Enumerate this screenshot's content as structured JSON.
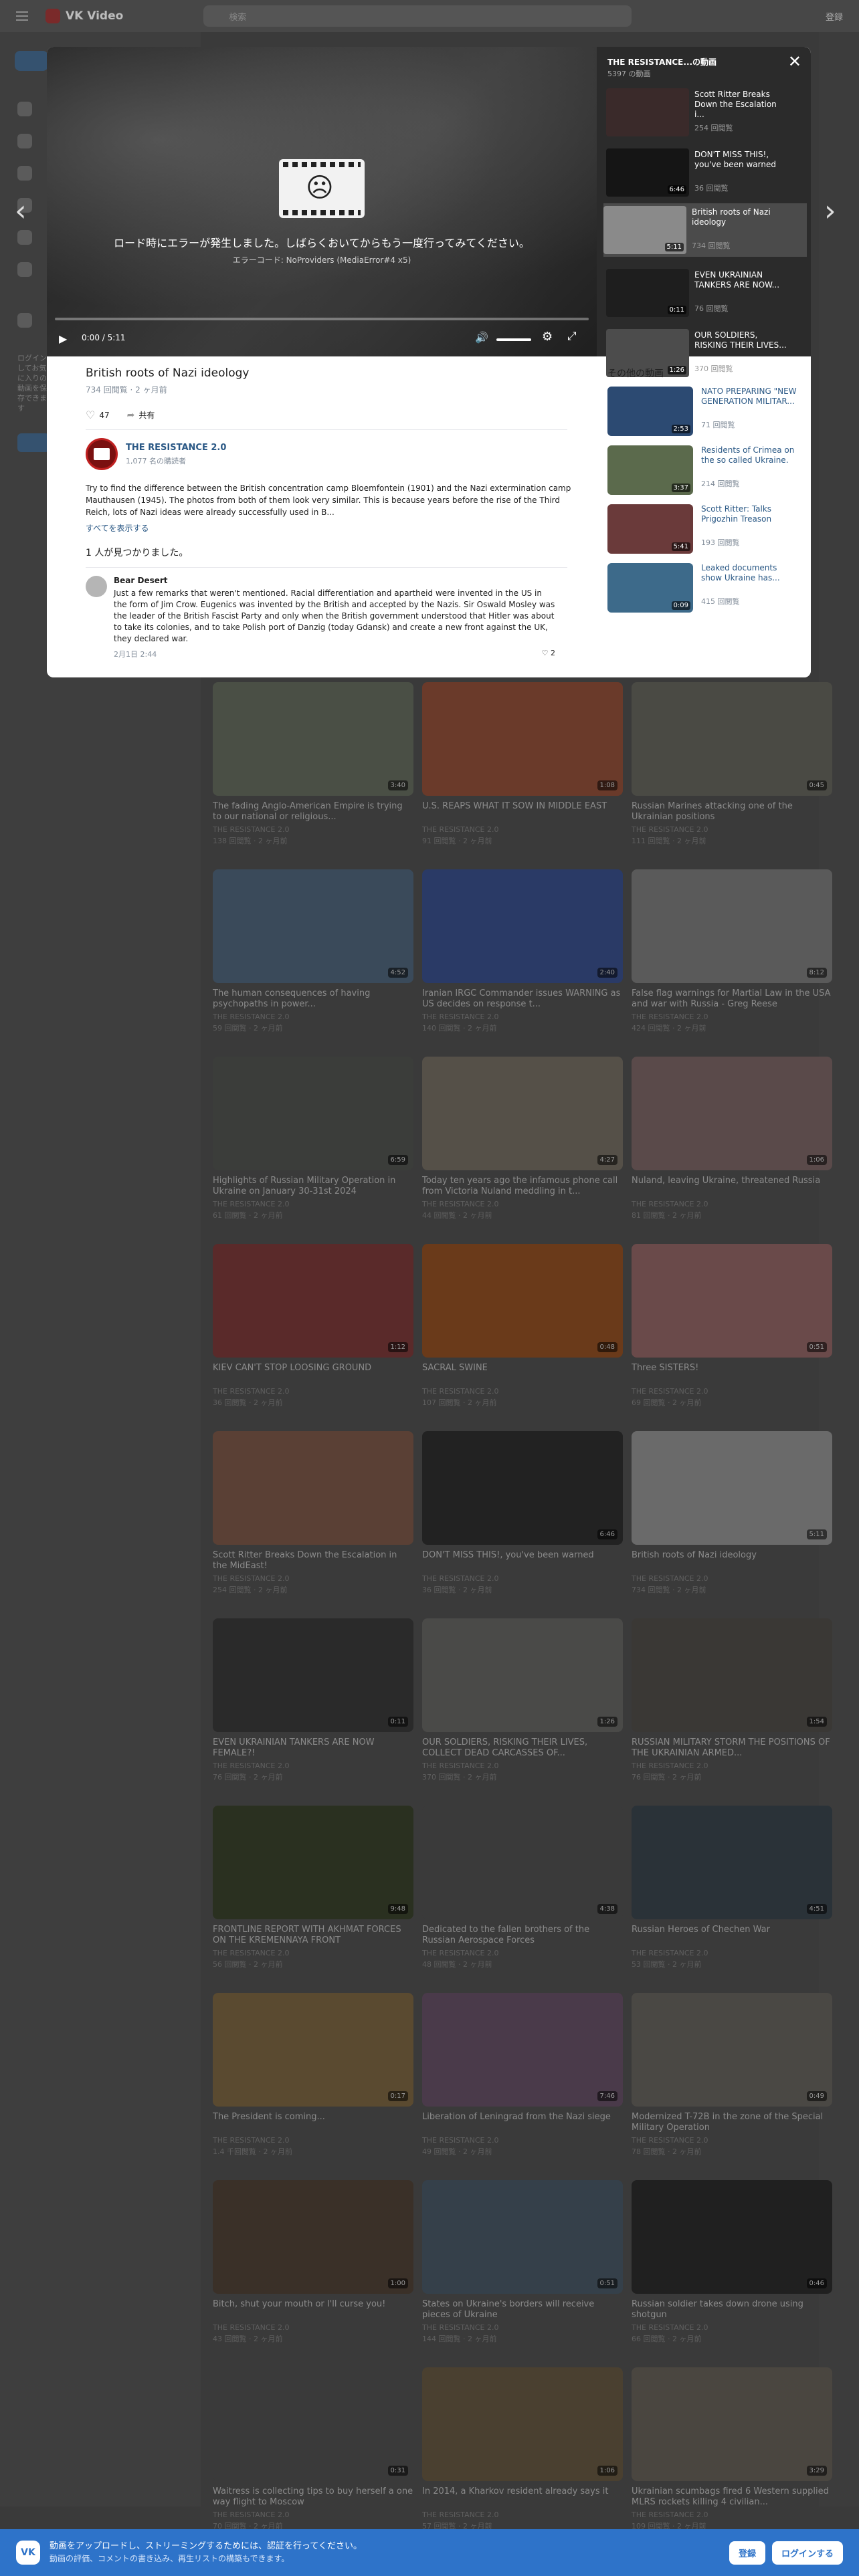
{
  "topbar": {
    "brand": "VK Video",
    "search_placeholder": "検索",
    "login": "登録"
  },
  "leftnav": {
    "note": "ログインしてお気に入りの動画を保存できます"
  },
  "player": {
    "error_message": "ロード時にエラーが発生しました。しばらくおいてからもう一度行ってみてください。",
    "error_code": "エラーコード: NoProviders (MediaError#4 x5)",
    "time": "0:00 / 5:11",
    "play_icon": "▶",
    "volume_icon": "🔊",
    "settings_icon": "⚙",
    "fullscreen_icon": "⤢",
    "progress_fraction": 0
  },
  "video": {
    "title": "British roots of Nazi ideology",
    "meta": "734 回閲覧 · 2 ヶ月前",
    "likes": "47",
    "share": "共有",
    "channel": {
      "name": "THE RESISTANCE 2.0",
      "subs": "1,077 名の購読者"
    },
    "description": "Try to find the difference between the British concentration camp Bloemfontein (1901) and the Nazi extermination camp Mauthausen (1945). The photos from both of them look very similar. This is because years before the rise of the Third Reich, lots of Nazi ideas were already successfully used in B...",
    "show_all": "すべてを表示する",
    "comments_header": "1 人が見つかりました。",
    "comment": {
      "author": "Bear Desert",
      "text": "Just a few remarks that weren't mentioned. Racial differentiation and apartheid were invented in the US in the form of Jim Crow. Eugenics was invented by the British and accepted by the Nazis. Sir Oswald Mosley was the leader of the British Fascist Party and only when the British government understood that Hitler was about to take its colonies, and to take Polish port of Danzig (today Gdansk) and create a new front against the UK, they declared war.",
      "date": "2月1日 2:44",
      "likes": "2"
    }
  },
  "playlist": {
    "title": "THE RESISTANCE...の動画",
    "count": "5397 の動画",
    "items": [
      {
        "title": "Scott Ritter Breaks Down the Escalation i...",
        "views": "254 回閲覧",
        "duration": "",
        "color": "#3a2a2a"
      },
      {
        "title": "DON'T MISS THIS!, you've been warned",
        "views": "36 回閲覧",
        "duration": "6:46",
        "color": "#151515"
      },
      {
        "title": "British roots of Nazi ideology",
        "views": "734 回閲覧",
        "duration": "5:11",
        "color": "#8a8a8a"
      },
      {
        "title": "EVEN UKRAINIAN TANKERS ARE NOW...",
        "views": "76 回閲覧",
        "duration": "0:11",
        "color": "#1e1e1e"
      },
      {
        "title": "OUR SOLDIERS, RISKING THEIR LIVES...",
        "views": "370 回閲覧",
        "duration": "1:26",
        "color": "#4c4c4c"
      }
    ]
  },
  "others": {
    "header": "その他の動画",
    "items": [
      {
        "title": "NATO PREPARING \"NEW GENERATION MILITAR...",
        "views": "71 回閲覧",
        "duration": "2:53",
        "color": "#2c4a72"
      },
      {
        "title": "Residents of Crimea on the so called Ukraine.",
        "views": "214 回閲覧",
        "duration": "3:37",
        "color": "#5b6a4c"
      },
      {
        "title": "Scott Ritter: Talks Prigozhin Treason",
        "views": "193 回閲覧",
        "duration": "5:41",
        "color": "#6a3a3a"
      },
      {
        "title": "Leaked documents show Ukraine has...",
        "views": "415 回閲覧",
        "duration": "0:09",
        "color": "#3d6a8a"
      }
    ]
  },
  "grid": [
    {
      "title": "The fading Anglo-American Empire is trying to our national or religious...",
      "channel": "THE RESISTANCE 2.0",
      "meta": "138 回閲覧 · 2 ヶ月前",
      "duration": "3:40",
      "color": "#4a4f45"
    },
    {
      "title": "U.S. REAPS WHAT IT SOW IN MIDDLE EAST",
      "channel": "THE RESISTANCE 2.0",
      "meta": "91 回閲覧 · 2 ヶ月前",
      "duration": "1:08",
      "color": "#6a3a2a"
    },
    {
      "title": "Russian Marines attacking one of the Ukrainian positions",
      "channel": "THE RESISTANCE 2.0",
      "meta": "111 回閲覧 · 2 ヶ月前",
      "duration": "0:45",
      "color": "#4a4a44"
    },
    {
      "title": "The human consequences of having psychopaths in power...",
      "channel": "THE RESISTANCE 2.0",
      "meta": "59 回閲覧 · 2 ヶ月前",
      "duration": "4:52",
      "color": "#3a4a5a"
    },
    {
      "title": "Iranian IRGC Commander issues WARNING as US decides on response t...",
      "channel": "THE RESISTANCE 2.0",
      "meta": "140 回閲覧 · 2 ヶ月前",
      "duration": "2:40",
      "color": "#2a3a66"
    },
    {
      "title": "False flag warnings for Martial Law in the USA and war with Russia - Greg Reese",
      "channel": "THE RESISTANCE 2.0",
      "meta": "424 回閲覧 · 2 ヶ月前",
      "duration": "8:12",
      "color": "#5a5a5a"
    },
    {
      "title": "Highlights of Russian Military Operation in Ukraine on January 30-31st 2024",
      "channel": "THE RESISTANCE 2.0",
      "meta": "61 回閲覧 · 2 ヶ月前",
      "duration": "6:59",
      "color": "#3b3d3a"
    },
    {
      "title": "Today ten years ago the infamous phone call from Victoria Nuland meddling in t...",
      "channel": "THE RESISTANCE 2.0",
      "meta": "44 回閲覧 · 2 ヶ月前",
      "duration": "4:27",
      "color": "#555048"
    },
    {
      "title": "Nuland, leaving Ukraine, threatened Russia",
      "channel": "THE RESISTANCE 2.0",
      "meta": "81 回閲覧 · 2 ヶ月前",
      "duration": "1:06",
      "color": "#5a4a4a"
    },
    {
      "title": "KIEV CAN'T STOP LOOSING GROUND",
      "channel": "THE RESISTANCE 2.0",
      "meta": "36 回閲覧 · 2 ヶ月前",
      "duration": "1:12",
      "color": "#5a2a2a"
    },
    {
      "title": "SACRAL SWINE",
      "channel": "THE RESISTANCE 2.0",
      "meta": "107 回閲覧 · 2 ヶ月前",
      "duration": "0:48",
      "color": "#6a3a1a"
    },
    {
      "title": "Three SISTERS!",
      "channel": "THE RESISTANCE 2.0",
      "meta": "69 回閲覧 · 2 ヶ月前",
      "duration": "0:51",
      "color": "#6a4a4a"
    },
    {
      "title": "Scott Ritter Breaks Down the Escalation in the MidEast!",
      "channel": "THE RESISTANCE 2.0",
      "meta": "254 回閲覧 · 2 ヶ月前",
      "duration": "",
      "color": "#5a4035"
    },
    {
      "title": "DON'T MISS THIS!, you've been warned",
      "channel": "THE RESISTANCE 2.0",
      "meta": "36 回閲覧 · 2 ヶ月前",
      "duration": "6:46",
      "color": "#222222"
    },
    {
      "title": "British roots of Nazi ideology",
      "channel": "THE RESISTANCE 2.0",
      "meta": "734 回閲覧 · 2 ヶ月前",
      "duration": "5:11",
      "color": "#6a6a6a"
    },
    {
      "title": "EVEN UKRAINIAN TANKERS ARE NOW FEMALE?!",
      "channel": "THE RESISTANCE 2.0",
      "meta": "76 回閲覧 · 2 ヶ月前",
      "duration": "0:11",
      "color": "#2a2a2a"
    },
    {
      "title": "OUR SOLDIERS, RISKING THEIR LIVES, COLLECT DEAD CARCASSES OF...",
      "channel": "THE RESISTANCE 2.0",
      "meta": "370 回閲覧 · 2 ヶ月前",
      "duration": "1:26",
      "color": "#4a4a48"
    },
    {
      "title": "RUSSIAN MILITARY STORM THE POSITIONS OF THE UKRAINIAN ARMED...",
      "channel": "THE RESISTANCE 2.0",
      "meta": "76 回閲覧 · 2 ヶ月前",
      "duration": "1:54",
      "color": "#3a3835"
    },
    {
      "title": "FRONTLINE REPORT WITH AKHMAT FORCES ON THE KREMENNAYA FRONT",
      "channel": "THE RESISTANCE 2.0",
      "meta": "56 回閲覧 · 2 ヶ月前",
      "duration": "9:48",
      "color": "#2a3020"
    },
    {
      "title": "Dedicated to the fallen brothers of the Russian Aerospace Forces",
      "channel": "THE RESISTANCE 2.0",
      "meta": "48 回閲覧 · 2 ヶ月前",
      "duration": "4:38",
      "color": "#3a3a3a"
    },
    {
      "title": "Russian Heroes of Chechen War",
      "channel": "THE RESISTANCE 2.0",
      "meta": "53 回閲覧 · 2 ヶ月前",
      "duration": "4:51",
      "color": "#2a3238"
    },
    {
      "title": "The President is coming...",
      "channel": "THE RESISTANCE 2.0",
      "meta": "1.4 千回閲覧 · 2 ヶ月前",
      "duration": "0:17",
      "color": "#5a4a30"
    },
    {
      "title": "Liberation of Leningrad from the Nazi siege",
      "channel": "THE RESISTANCE 2.0",
      "meta": "49 回閲覧 · 2 ヶ月前",
      "duration": "7:46",
      "color": "#4a3a4a"
    },
    {
      "title": "Modernized T-72B in the zone of the Special Military Operation",
      "channel": "THE RESISTANCE 2.0",
      "meta": "78 回閲覧 · 2 ヶ月前",
      "duration": "0:49",
      "color": "#4a4844"
    },
    {
      "title": "Bitch, shut your mouth or I'll curse you!",
      "channel": "THE RESISTANCE 2.0",
      "meta": "43 回閲覧 · 2 ヶ月前",
      "duration": "1:00",
      "color": "#3a3028"
    },
    {
      "title": "States on Ukraine's borders will receive pieces of Ukraine",
      "channel": "THE RESISTANCE 2.0",
      "meta": "144 回閲覧 · 2 ヶ月前",
      "duration": "0:51",
      "color": "#35404a"
    },
    {
      "title": "Russian soldier takes down drone using shotgun",
      "channel": "THE RESISTANCE 2.0",
      "meta": "66 回閲覧 · 2 ヶ月前",
      "duration": "0:46",
      "color": "#202020"
    },
    {
      "title": "Waitress is collecting tips to buy herself a one way flight to Moscow",
      "channel": "THE RESISTANCE 2.0",
      "meta": "70 回閲覧 · 2 ヶ月前",
      "duration": "0:31",
      "color": "#3a3a3a"
    },
    {
      "title": "In 2014, a Kharkov resident already says it",
      "channel": "THE RESISTANCE 2.0",
      "meta": "57 回閲覧 · 2 ヶ月前",
      "duration": "1:06",
      "color": "#4a4030"
    },
    {
      "title": "Ukrainian scumbags fired 6 Western supplied MLRS rockets killing 4 civilian...",
      "channel": "THE RESISTANCE 2.0",
      "meta": "109 回閲覧 · 2 ヶ月前",
      "duration": "3:29",
      "color": "#4a4640"
    }
  ],
  "bottombar": {
    "line1": "動画をアップロードし、ストリーミングするためには、認証を行ってください。",
    "line2": "動画の評価、コメントの書き込み、再生リストの構築もできます。",
    "signup": "登録",
    "login": "ログインする"
  }
}
